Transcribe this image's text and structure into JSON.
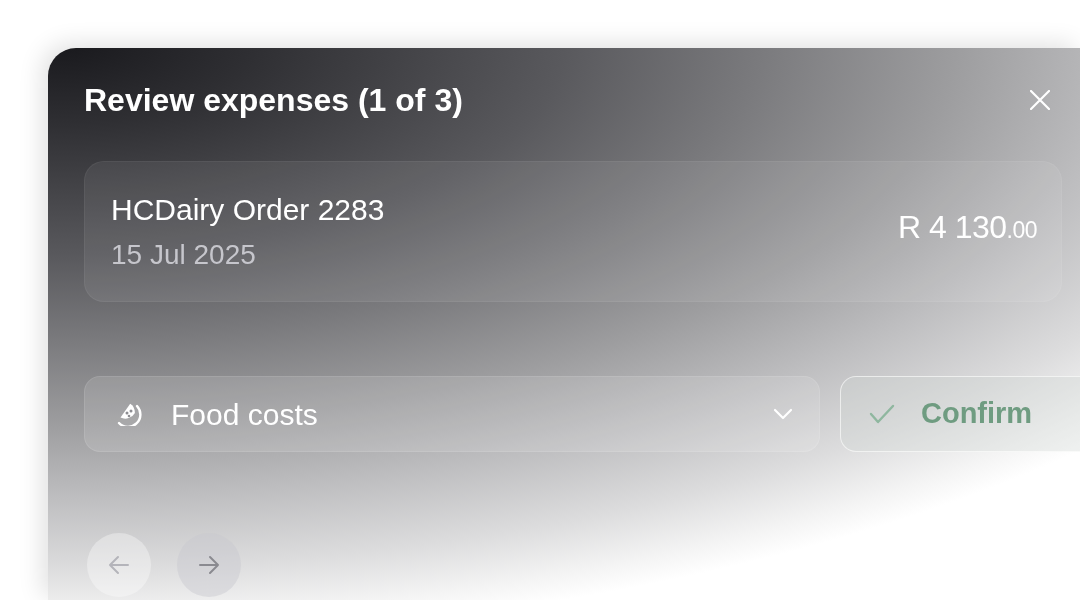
{
  "dialog": {
    "title": "Review expenses (1 of 3)"
  },
  "expense": {
    "name": "HCDairy Order 2283",
    "date": "15 Jul 2025",
    "amount": "R 4 130",
    "amount_cents": ".00"
  },
  "category": {
    "label": "Food costs"
  },
  "confirm": {
    "label": "Confirm"
  },
  "navigation": [
    {
      "kind": "previous",
      "disabled": true
    },
    {
      "kind": "next",
      "disabled": false
    }
  ]
}
